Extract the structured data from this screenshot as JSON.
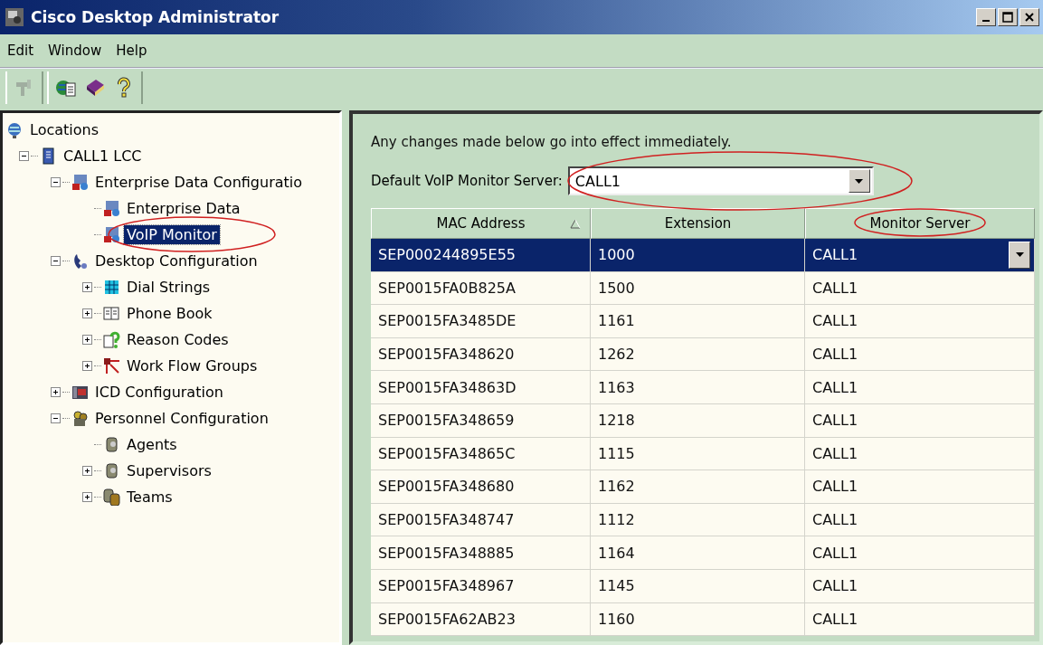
{
  "window": {
    "title": "Cisco Desktop Administrator"
  },
  "menu": [
    "Edit",
    "Window",
    "Help"
  ],
  "toolbar": [
    {
      "disabled": true
    },
    {
      "disabled": false
    },
    {
      "disabled": false
    },
    {
      "disabled": false
    }
  ],
  "tree": [
    {
      "label": "Locations",
      "selected": false,
      "children": [
        {
          "label": "CALL1 LCC",
          "selected": false,
          "expanded": true,
          "children": [
            {
              "label": "Enterprise Data Configuratio",
              "selected": false,
              "expanded": true,
              "children": [
                {
                  "label": "Enterprise Data",
                  "selected": false
                },
                {
                  "label": "VoIP Monitor",
                  "selected": true
                }
              ]
            },
            {
              "label": "Desktop Configuration",
              "selected": false,
              "expanded": true,
              "children": [
                {
                  "label": "Dial Strings",
                  "selected": false,
                  "expanded": false
                },
                {
                  "label": "Phone Book",
                  "selected": false,
                  "expanded": false
                },
                {
                  "label": "Reason Codes",
                  "selected": false,
                  "expanded": false
                },
                {
                  "label": "Work Flow Groups",
                  "selected": false,
                  "expanded": false
                }
              ]
            },
            {
              "label": "ICD Configuration",
              "selected": false,
              "expanded": false
            },
            {
              "label": "Personnel Configuration",
              "selected": false,
              "expanded": true,
              "children": [
                {
                  "label": "Agents",
                  "selected": false
                },
                {
                  "label": "Supervisors",
                  "selected": false,
                  "expanded": false
                },
                {
                  "label": "Teams",
                  "selected": false,
                  "expanded": false
                }
              ]
            }
          ]
        }
      ]
    }
  ],
  "panel": {
    "notice": "Any changes made below go into effect immediately.",
    "default_server": {
      "label": "Default VoIP Monitor Server:",
      "value": "CALL1"
    }
  },
  "table": {
    "columns": [
      {
        "label": "MAC Address",
        "sorted": true
      },
      {
        "label": "Extension",
        "sorted": false
      },
      {
        "label": "Monitor Server",
        "sorted": false
      }
    ],
    "rows": [
      {
        "cells": [
          "SEP000244895E55",
          "1000",
          "CALL1"
        ],
        "selected": true
      },
      {
        "cells": [
          "SEP0015FA0B825A",
          "1500",
          "CALL1"
        ],
        "selected": false
      },
      {
        "cells": [
          "SEP0015FA3485DE",
          "1161",
          "CALL1"
        ],
        "selected": false
      },
      {
        "cells": [
          "SEP0015FA348620",
          "1262",
          "CALL1"
        ],
        "selected": false
      },
      {
        "cells": [
          "SEP0015FA34863D",
          "1163",
          "CALL1"
        ],
        "selected": false
      },
      {
        "cells": [
          "SEP0015FA348659",
          "1218",
          "CALL1"
        ],
        "selected": false
      },
      {
        "cells": [
          "SEP0015FA34865C",
          "1115",
          "CALL1"
        ],
        "selected": false
      },
      {
        "cells": [
          "SEP0015FA348680",
          "1162",
          "CALL1"
        ],
        "selected": false
      },
      {
        "cells": [
          "SEP0015FA348747",
          "1112",
          "CALL1"
        ],
        "selected": false
      },
      {
        "cells": [
          "SEP0015FA348885",
          "1164",
          "CALL1"
        ],
        "selected": false
      },
      {
        "cells": [
          "SEP0015FA348967",
          "1145",
          "CALL1"
        ],
        "selected": false
      },
      {
        "cells": [
          "SEP0015FA62AB23",
          "1160",
          "CALL1"
        ],
        "selected": false
      }
    ]
  }
}
